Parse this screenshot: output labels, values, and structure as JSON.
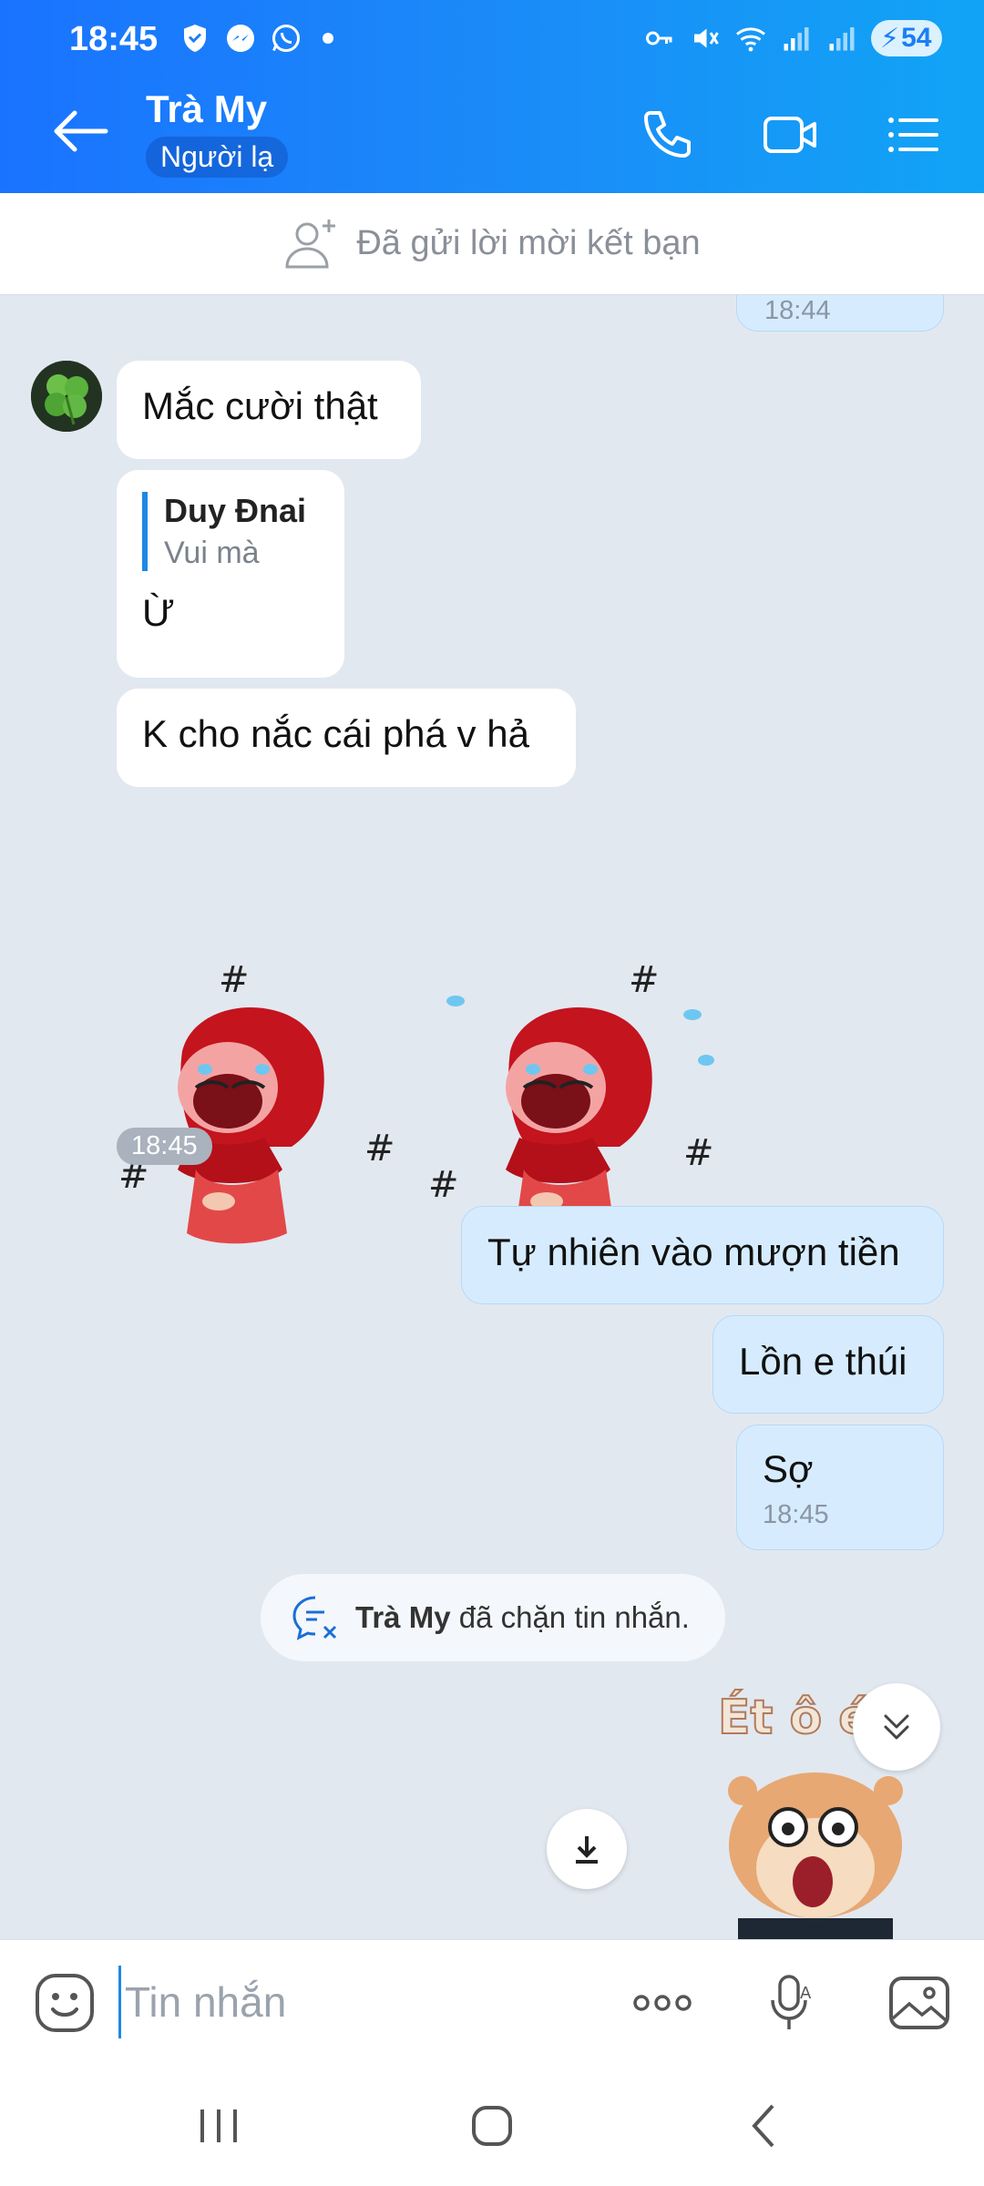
{
  "status_bar": {
    "time": "18:45",
    "battery": "54"
  },
  "header": {
    "title": "Trà My",
    "subtitle": "Người lạ"
  },
  "friend_request": {
    "text": "Đã gửi lời mời kết bạn"
  },
  "messages": {
    "prev_timestamp": "18:44",
    "m1": "Mắc cười thật",
    "reply_name": "Duy Đnai",
    "reply_quote": "Vui mà",
    "m2": "Ừ",
    "m3": "K cho nắc cái phá v hả",
    "sticker_time": "18:45",
    "o1": "Tự nhiên vào mượn tiền",
    "o2": "Lồn e thúi",
    "o3": "Sợ",
    "o3_time": "18:45"
  },
  "blocked_notice": {
    "name": "Trà My",
    "text": "đã chặn tin nhắn."
  },
  "sticker_caption": "Ét ô ét",
  "input": {
    "placeholder": "Tin nhắn"
  },
  "colors": {
    "header_start": "#1a73ff",
    "header_end": "#11a4f6",
    "outgoing_bubble": "#d6ecfe",
    "chat_bg": "#e2e8f0"
  }
}
